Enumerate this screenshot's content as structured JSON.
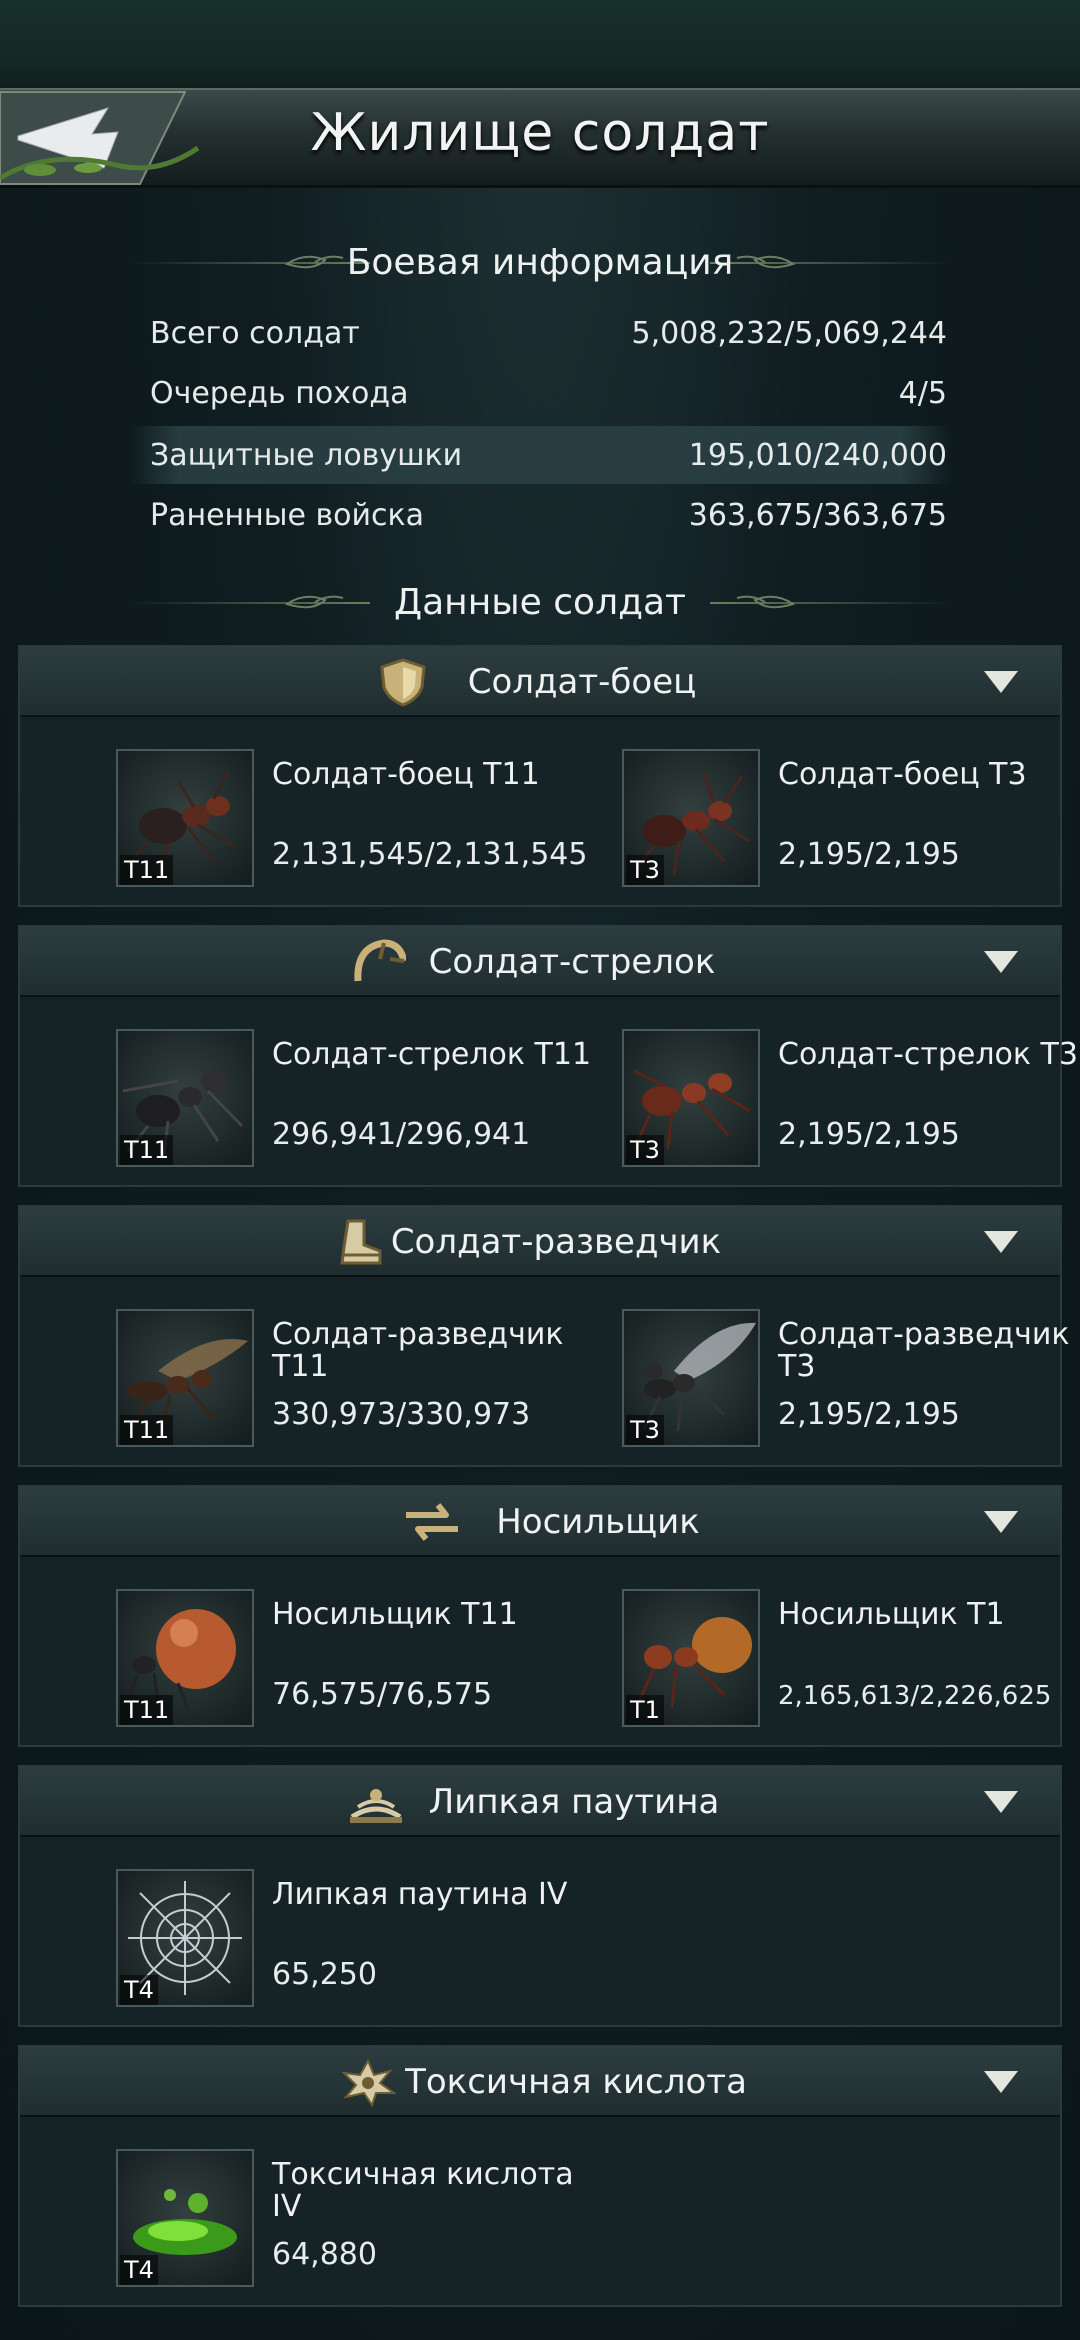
{
  "header": {
    "title": "Жилище солдат"
  },
  "battle_info": {
    "title": "Боевая информация",
    "rows": [
      {
        "label": "Всего солдат",
        "value": "5,008,232/5,069,244"
      },
      {
        "label": "Очередь похода",
        "value": "4/5"
      },
      {
        "label": "Защитные ловушки",
        "value": "195,010/240,000"
      },
      {
        "label": "Раненные войска",
        "value": "363,675/363,675"
      }
    ]
  },
  "soldier_data": {
    "title": "Данные солдат"
  },
  "categories": [
    {
      "title": "Солдат-боец",
      "icon": "shield-icon",
      "units": [
        {
          "name": "Солдат-боец T11",
          "tier": "T11",
          "count": "2,131,545/2,131,545"
        },
        {
          "name": "Солдат-боец T3",
          "tier": "T3",
          "count": "2,195/2,195"
        }
      ]
    },
    {
      "title": "Солдат-стрелок",
      "icon": "bow-icon",
      "units": [
        {
          "name": "Солдат-стрелок T11",
          "tier": "T11",
          "count": "296,941/296,941"
        },
        {
          "name": "Солдат-стрелок T3",
          "tier": "T3",
          "count": "2,195/2,195"
        }
      ]
    },
    {
      "title": "Солдат-разведчик",
      "icon": "boot-icon",
      "units": [
        {
          "name": "Солдат-разведчик T11",
          "tier": "T11",
          "count": "330,973/330,973"
        },
        {
          "name": "Солдат-разведчик T3",
          "tier": "T3",
          "count": "2,195/2,195"
        }
      ]
    },
    {
      "title": "Носильщик",
      "icon": "transfer-icon",
      "units": [
        {
          "name": "Носильщик T11",
          "tier": "T11",
          "count": "76,575/76,575"
        },
        {
          "name": "Носильщик T1",
          "tier": "T1",
          "count": "2,165,613/2,226,625"
        }
      ]
    },
    {
      "title": "Липкая паутина",
      "icon": "web-trap-icon",
      "units": [
        {
          "name": "Липкая паутина IV",
          "tier": "T4",
          "count": "65,250"
        }
      ]
    },
    {
      "title": "Токсичная кислота",
      "icon": "acid-icon",
      "units": [
        {
          "name": "Токсичная кислота IV",
          "tier": "T4",
          "count": "64,880"
        }
      ]
    }
  ],
  "colors": {
    "background": "#0d1a1e",
    "header": "#24302f",
    "category_bar": "#2d3d3f",
    "divider": "#6a7f62"
  }
}
